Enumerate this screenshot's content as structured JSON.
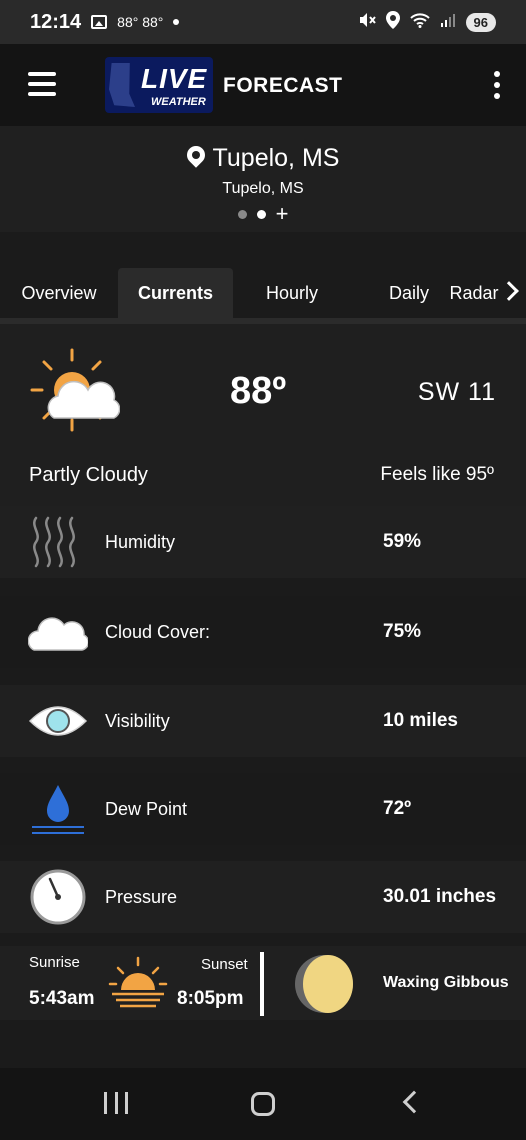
{
  "status_bar": {
    "time": "12:14",
    "temps": "88° 88°",
    "battery": "96"
  },
  "app_bar": {
    "logo_text": "LIVE",
    "logo_sub": "WEATHER",
    "title": "FORECAST"
  },
  "location": {
    "name": "Tupelo, MS",
    "subtitle": "Tupelo, MS",
    "plus": "+"
  },
  "tabs": [
    {
      "label": "Overview",
      "active": false
    },
    {
      "label": "Currents",
      "active": true
    },
    {
      "label": "Hourly",
      "active": false
    },
    {
      "label": "Daily",
      "active": false
    },
    {
      "label": "Radar",
      "active": false
    }
  ],
  "current": {
    "temperature": "88º",
    "wind": "SW  11",
    "condition": "Partly Cloudy",
    "feels_like": "Feels like 95º",
    "icon": "partly-cloudy-icon"
  },
  "details": [
    {
      "label": "Humidity",
      "value": "59%",
      "icon": "humidity-icon"
    },
    {
      "label": "Cloud Cover:",
      "value": "75%",
      "icon": "cloud-icon"
    },
    {
      "label": "Visibility",
      "value": "10 miles",
      "icon": "eye-icon"
    },
    {
      "label": "Dew Point",
      "value": "72º",
      "icon": "droplet-icon"
    },
    {
      "label": "Pressure",
      "value": "30.01 inches",
      "icon": "gauge-icon"
    }
  ],
  "sun": {
    "sunrise_label": "Sunrise",
    "sunrise_time": "5:43am",
    "sunset_label": "Sunset",
    "sunset_time": "8:05pm"
  },
  "moon": {
    "phase": "Waxing Gibbous"
  },
  "colors": {
    "sun": "#f2a444",
    "moon": "#f0d682",
    "droplet": "#2e6fd8",
    "eye": "#9fe3ec"
  }
}
